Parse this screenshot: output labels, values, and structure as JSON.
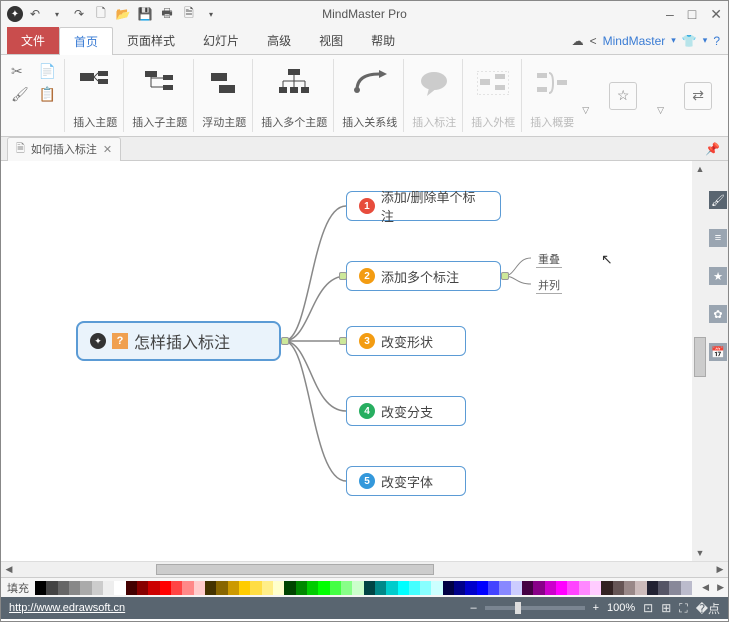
{
  "app": {
    "title": "MindMaster Pro"
  },
  "qat_dropdown": "▾",
  "window_controls": {
    "min": "–",
    "max": "□",
    "close": "✕"
  },
  "menu": {
    "file": "文件",
    "tabs": [
      "首页",
      "页面样式",
      "幻灯片",
      "高级",
      "视图",
      "帮助"
    ],
    "active_index": 0,
    "brand": "MindMaster",
    "brand_caret": "▾"
  },
  "ribbon": {
    "insert_topic": "插入主题",
    "insert_subtopic": "插入子主题",
    "floating_topic": "浮动主题",
    "insert_multi_topic": "插入多个主题",
    "insert_relation": "插入关系线",
    "insert_callout": "插入标注",
    "insert_boundary": "插入外框",
    "insert_summary": "插入概要"
  },
  "doc_tab": {
    "name": "如何插入标注",
    "close": "✕"
  },
  "mindmap": {
    "root": "怎样插入标注",
    "children": [
      {
        "num": "1",
        "label": "添加/删除单个标注",
        "color": "b-red"
      },
      {
        "num": "2",
        "label": "添加多个标注",
        "color": "b-orange"
      },
      {
        "num": "3",
        "label": "改变形状",
        "color": "b-orange"
      },
      {
        "num": "4",
        "label": "改变分支",
        "color": "b-green"
      },
      {
        "num": "5",
        "label": "改变字体",
        "color": "b-blue"
      }
    ],
    "sublabels": [
      "重叠",
      "并列"
    ]
  },
  "palette_label": "填充",
  "statusbar": {
    "url": "http://www.edrawsoft.cn",
    "zoom_minus": "–",
    "zoom_plus": "+",
    "zoom": "100%"
  },
  "palette_colors": [
    "#000",
    "#444",
    "#666",
    "#888",
    "#aaa",
    "#ccc",
    "#eee",
    "#fff",
    "#400",
    "#800",
    "#c00",
    "#f00",
    "#f44",
    "#f88",
    "#fcc",
    "#430",
    "#860",
    "#c90",
    "#fc0",
    "#fd4",
    "#fe8",
    "#ffc",
    "#040",
    "#080",
    "#0c0",
    "#0f0",
    "#4f4",
    "#8f8",
    "#cfc",
    "#044",
    "#088",
    "#0cc",
    "#0ff",
    "#4ff",
    "#8ff",
    "#cff",
    "#004",
    "#008",
    "#00c",
    "#00f",
    "#44f",
    "#88f",
    "#ccf",
    "#404",
    "#808",
    "#c0c",
    "#f0f",
    "#f4f",
    "#f8f",
    "#fcf",
    "#322",
    "#655",
    "#988",
    "#cbb",
    "#223",
    "#556",
    "#889",
    "#bbc"
  ]
}
